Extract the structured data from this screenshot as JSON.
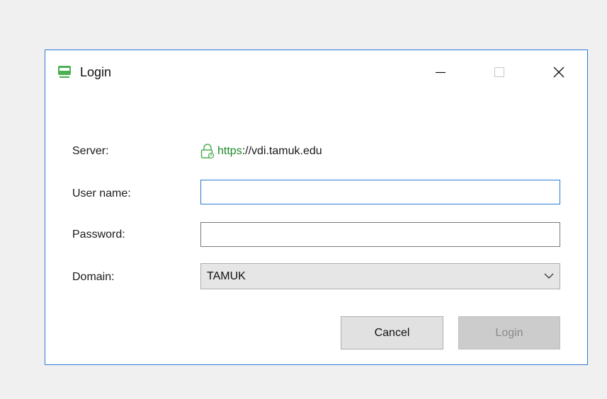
{
  "window": {
    "title": "Login",
    "icon": "monitor-icon",
    "controls": {
      "minimize": "minimize-icon",
      "maximize": "maximize-icon",
      "close": "close-icon"
    }
  },
  "form": {
    "server": {
      "label": "Server:",
      "icon": "lock-icon",
      "scheme": "https",
      "address": "://vdi.tamuk.edu"
    },
    "username": {
      "label": "User name:",
      "value": "",
      "placeholder": ""
    },
    "password": {
      "label": "Password:",
      "value": "",
      "placeholder": ""
    },
    "domain": {
      "label": "Domain:",
      "selected": "TAMUK"
    }
  },
  "buttons": {
    "cancel": "Cancel",
    "login": "Login"
  },
  "colors": {
    "accent": "#2b79d7",
    "secure_green": "#1e8a28",
    "icon_green": "#4caf50",
    "disabled_bg": "#cccccc",
    "disabled_text": "#8a8a8a"
  }
}
